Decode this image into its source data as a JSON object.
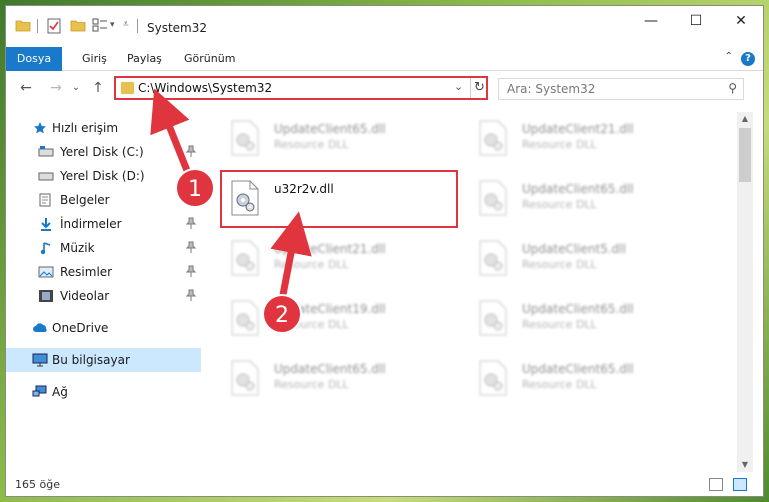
{
  "window": {
    "title": "System32",
    "minimize_glyph": "—",
    "maximize_glyph": "☐",
    "close_glyph": "✕"
  },
  "ribbon": {
    "tabs": [
      {
        "label": "Dosya",
        "active": true
      },
      {
        "label": "Giriş",
        "active": false
      },
      {
        "label": "Paylaş",
        "active": false
      },
      {
        "label": "Görünüm",
        "active": false
      }
    ],
    "help_glyph": "?",
    "collapse_glyph": "⌃"
  },
  "nav": {
    "back_glyph": "←",
    "forward_glyph": "→",
    "recent_glyph": "⌄",
    "up_glyph": "↑",
    "address": "C:\\Windows\\System32",
    "dropdown_glyph": "⌄",
    "refresh_glyph": "↻",
    "search_placeholder": "Ara: System32",
    "search_glyph": "⚲"
  },
  "sidebar": {
    "items": [
      {
        "label": "Hızlı erişim",
        "icon": "star-icon",
        "pinned": false,
        "indent": 0
      },
      {
        "label": "Yerel Disk (C:)",
        "icon": "drive-icon",
        "pinned": true,
        "indent": 1
      },
      {
        "label": "Yerel Disk (D:)",
        "icon": "drive-icon",
        "pinned": false,
        "indent": 1
      },
      {
        "label": "Belgeler",
        "icon": "documents-icon",
        "pinned": true,
        "indent": 1
      },
      {
        "label": "İndirmeler",
        "icon": "download-icon",
        "pinned": true,
        "indent": 1
      },
      {
        "label": "Müzik",
        "icon": "music-icon",
        "pinned": true,
        "indent": 1
      },
      {
        "label": "Resimler",
        "icon": "pictures-icon",
        "pinned": true,
        "indent": 1
      },
      {
        "label": "Videolar",
        "icon": "video-icon",
        "pinned": true,
        "indent": 1
      },
      {
        "label": "OneDrive",
        "icon": "cloud-icon",
        "pinned": false,
        "indent": 0
      },
      {
        "label": "Bu bilgisayar",
        "icon": "computer-icon",
        "pinned": false,
        "indent": 0,
        "selected": true
      },
      {
        "label": "Ağ",
        "icon": "network-icon",
        "pinned": false,
        "indent": 0
      }
    ],
    "pin_glyph": "📌"
  },
  "files": {
    "left": [
      {
        "name": "UpdateClient65.dll",
        "type": "Resource DLL"
      },
      {
        "name": "u32r2v.dll",
        "type": "",
        "highlighted": true
      },
      {
        "name": "UpdateClient21.dll",
        "type": "Resource DLL"
      },
      {
        "name": "UpdateClient19.dll",
        "type": "Resource DLL"
      },
      {
        "name": "UpdateClient65.dll",
        "type": "Resource DLL"
      }
    ],
    "right": [
      {
        "name": "UpdateClient21.dll",
        "type": "Resource DLL"
      },
      {
        "name": "UpdateClient65.dll",
        "type": "Resource DLL"
      },
      {
        "name": "UpdateClient5.dll",
        "type": "Resource DLL"
      },
      {
        "name": "UpdateClient65.dll",
        "type": "Resource DLL"
      },
      {
        "name": "UpdateClient65.dll",
        "type": "Resource DLL"
      }
    ]
  },
  "status": {
    "count_text": "165 öğe"
  },
  "annotations": {
    "badge1": "1",
    "badge2": "2",
    "color": "#e0343e"
  },
  "colors": {
    "accent": "#1979ca",
    "selected_bg": "#cce8ff",
    "highlight_red": "#e0343e"
  }
}
